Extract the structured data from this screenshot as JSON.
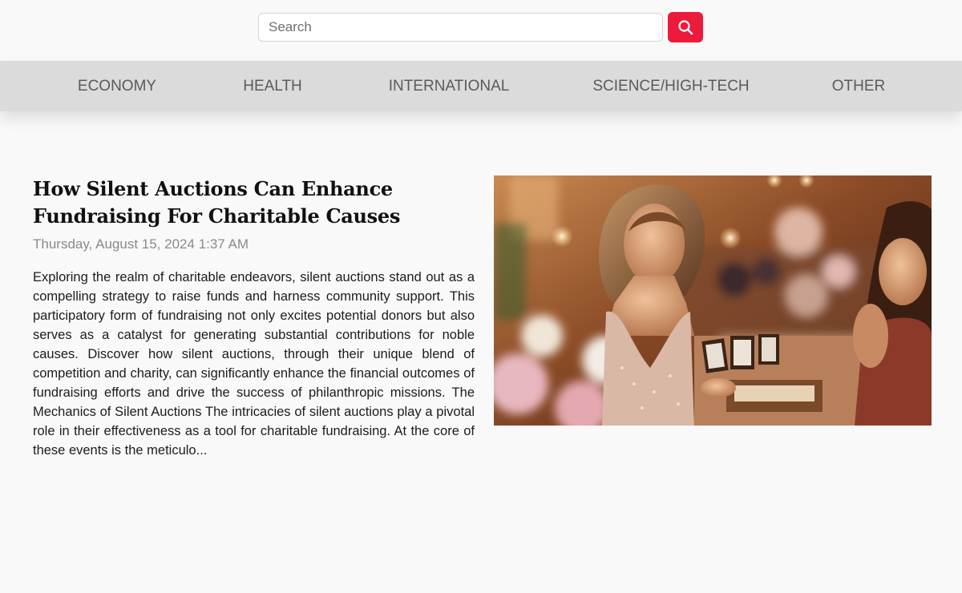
{
  "search": {
    "placeholder": "Search",
    "button_icon": "search-icon",
    "accent_color": "#ec1a3b"
  },
  "nav": {
    "items": [
      {
        "label": "ECONOMY"
      },
      {
        "label": "HEALTH"
      },
      {
        "label": "INTERNATIONAL"
      },
      {
        "label": "SCIENCE/HIGH-TECH"
      },
      {
        "label": "OTHER"
      }
    ]
  },
  "article": {
    "title": "How Silent Auctions Can Enhance Fundraising For Charitable Causes",
    "date": "Thursday, August 15, 2024 1:37 AM",
    "excerpt": "Exploring the realm of charitable endeavors, silent auctions stand out as a compelling strategy to raise funds and harness community support. This participatory form of fundraising not only excites potential donors but also serves as a catalyst for generating substantial contributions for noble causes. Discover how silent auctions, through their unique blend of competition and charity, can significantly enhance the financial outcomes of fundraising efforts and drive the success of philanthropic missions. The Mechanics of Silent Auctions The intricacies of silent auctions play a pivotal role in their effectiveness as a tool for charitable fundraising. At the core of these events is the meticulo..."
  }
}
